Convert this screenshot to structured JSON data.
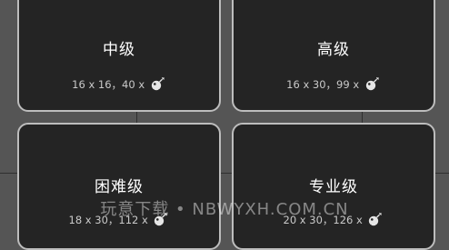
{
  "levels": [
    {
      "title": "中级",
      "info": "16 x 16，40 x",
      "icon": "bomb-icon"
    },
    {
      "title": "高级",
      "info": "16 x 30，99 x",
      "icon": "bomb-icon"
    },
    {
      "title": "困难级",
      "info": "18 x 30，112 x",
      "icon": "bomb-icon"
    },
    {
      "title": "专业级",
      "info": "20 x 30，126 x",
      "icon": "bomb-icon"
    }
  ],
  "watermark": "玩意下载 • NBWYXH.COM.CN",
  "colors": {
    "background": "#555555",
    "card": "#242424",
    "card_border": "#bdbdbd",
    "title_text": "#ffffff",
    "info_text": "#c9c9c9"
  }
}
